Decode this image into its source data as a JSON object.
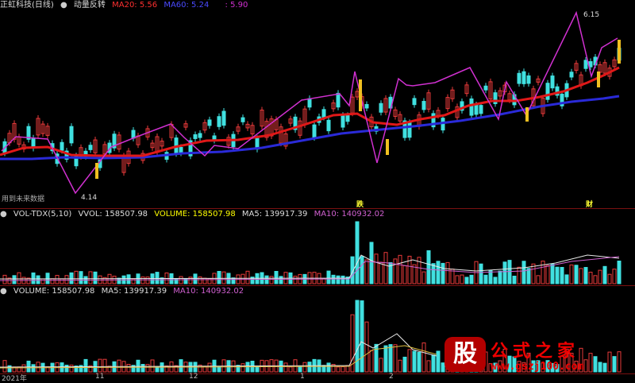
{
  "main_panel": {
    "title": "正虹科技(日线)",
    "indicator_name": "动量反转",
    "ma20_label": "MA20: 5.56",
    "ma60_label": "MA60: 5.24",
    "extra_value": ": 5.90",
    "high_marker": "6.15",
    "low_marker": "4.14",
    "future_data_note": "用到未来数据",
    "badge_down": "跌",
    "badge_finance": "财",
    "colors": {
      "ma20": "#e01818",
      "ma60": "#2a2ad8",
      "signal": "#d030d0",
      "up": "#e83a3a",
      "down": "#40e0e0"
    }
  },
  "volume_panel_1": {
    "label": "VOL-TDX(5,10)",
    "vvol": "VVOL: 158507.98",
    "volume": "VOLUME: 158507.98",
    "ma5": "MA5: 139917.39",
    "ma10": "MA10: 140932.02"
  },
  "volume_panel_2": {
    "volume": "VOLUME: 158507.98",
    "ma5": "MA5: 139917.39",
    "ma10": "MA10: 140932.02"
  },
  "time_axis": [
    "2021年",
    "11",
    "12",
    "1",
    "2"
  ],
  "logo": {
    "stamp": "股",
    "title": "公式之家",
    "url": "www.gszj100.com"
  }
}
